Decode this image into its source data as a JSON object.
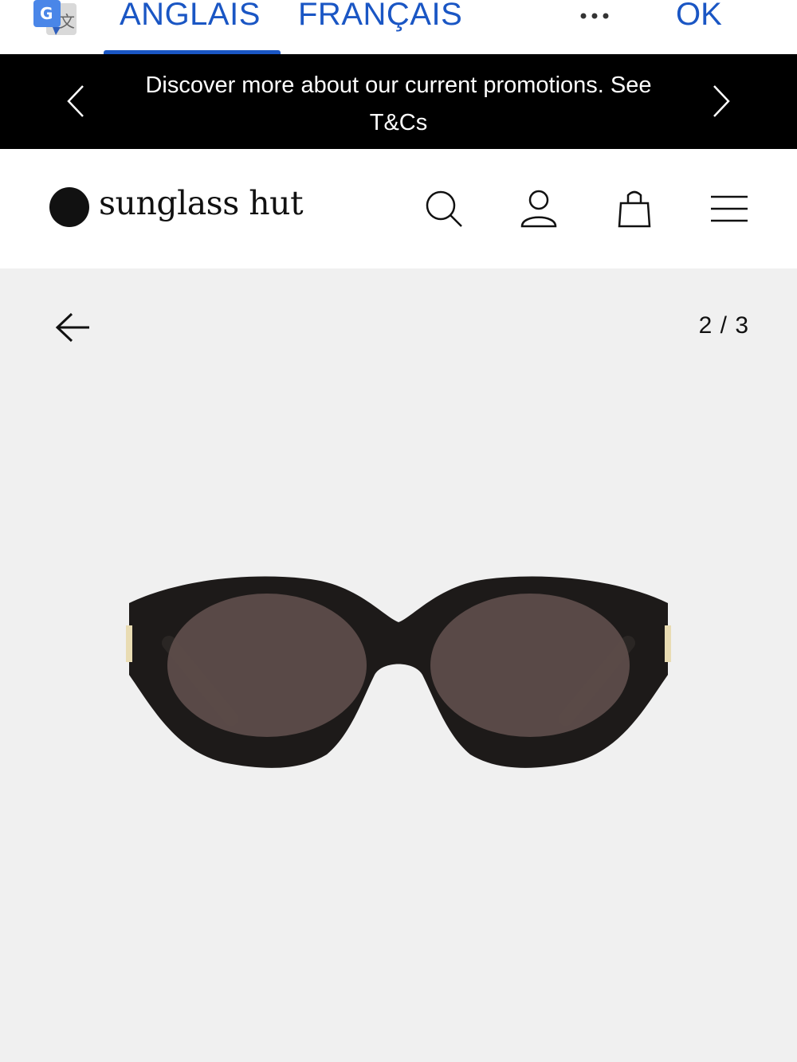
{
  "translate_bar": {
    "source_language": "ANGLAIS",
    "target_language": "FRANÇAIS",
    "ok_label": "OK",
    "active_tab": "source",
    "accent_color": "#1a56c4"
  },
  "promo_banner": {
    "text": "Discover more about our current promotions. See T&Cs",
    "prev_icon": "chevron-left-icon",
    "next_icon": "chevron-right-icon"
  },
  "header": {
    "logo_text": "sunglass hut",
    "icons": [
      "search-icon",
      "user-icon",
      "shopping-bag-icon",
      "hamburger-menu-icon"
    ]
  },
  "gallery": {
    "counter": "2 / 3",
    "back_icon": "arrow-left-icon",
    "product_image": "black-cat-eye-sunglasses"
  }
}
